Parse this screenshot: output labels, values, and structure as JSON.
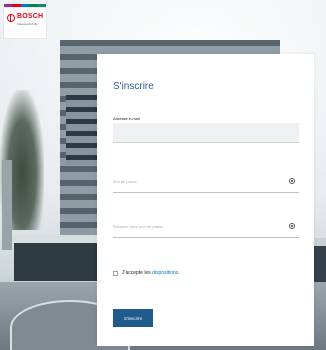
{
  "brand": {
    "name": "BOSCH",
    "tagline": "Invented for life",
    "colors": {
      "red": "#ea0016",
      "blue": "#007bc0",
      "button": "#1f5c8d"
    }
  },
  "form": {
    "title": "S'inscrire",
    "email_label": "Adresse e-mail",
    "email_value": "",
    "password_placeholder": "Mot de passe",
    "confirm_placeholder": "Retapez votre mot de passe",
    "eye_icon": "eye-icon",
    "terms_prefix": "J'accepte les ",
    "terms_link": "dispositions",
    "terms_suffix": ".",
    "submit_label": "S'inscrire"
  }
}
